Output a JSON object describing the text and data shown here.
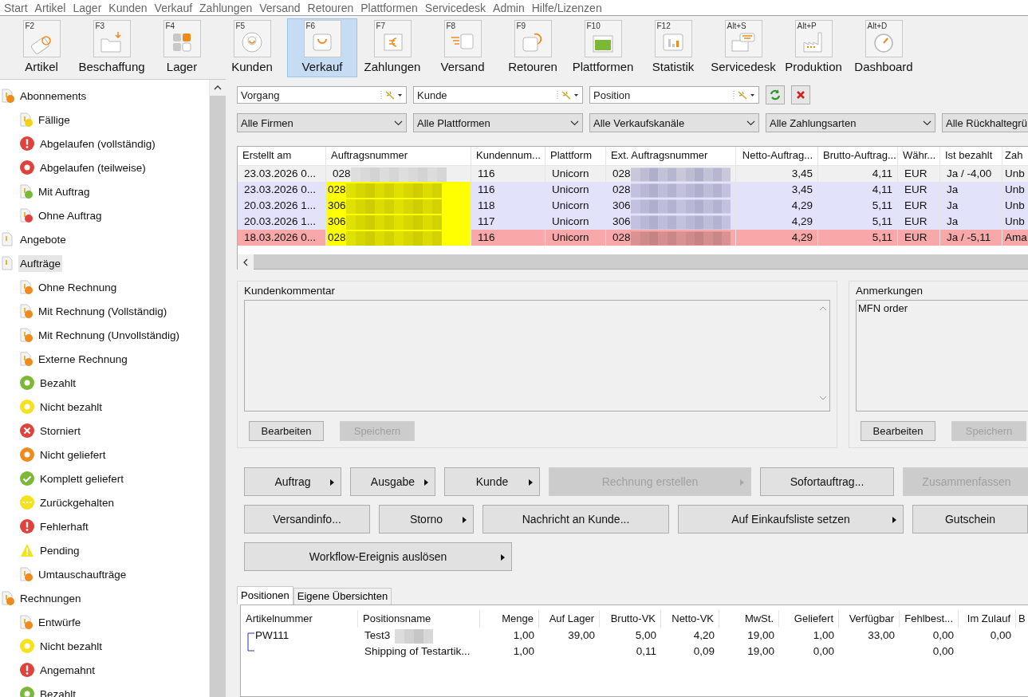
{
  "menu": [
    "Start",
    "Artikel",
    "Lager",
    "Kunden",
    "Verkauf",
    "Zahlungen",
    "Versand",
    "Retouren",
    "Plattformen",
    "Servicedesk",
    "Admin",
    "Hilfe/Lizenzen"
  ],
  "toolbar": [
    {
      "key": "F2",
      "label": "Artikel",
      "selected": false
    },
    {
      "key": "F3",
      "label": "Beschaffung",
      "selected": false
    },
    {
      "key": "F4",
      "label": "Lager",
      "selected": false
    },
    {
      "key": "F5",
      "label": "Kunden",
      "selected": false
    },
    {
      "key": "F6",
      "label": "Verkauf",
      "selected": true
    },
    {
      "key": "F7",
      "label": "Zahlungen",
      "selected": false
    },
    {
      "key": "F8",
      "label": "Versand",
      "selected": false
    },
    {
      "key": "F9",
      "label": "Retouren",
      "selected": false
    },
    {
      "key": "F10",
      "label": "Plattformen",
      "selected": false
    },
    {
      "key": "F12",
      "label": "Statistik",
      "selected": false
    },
    {
      "key": "Alt+S",
      "label": "Servicedesk",
      "selected": false
    },
    {
      "key": "Alt+P",
      "label": "Produktion",
      "selected": false
    },
    {
      "key": "Alt+D",
      "label": "Dashboard",
      "selected": false
    }
  ],
  "sidebar": {
    "items": [
      {
        "label": "Abonnements",
        "kind": "doc",
        "color": "#f08a1c",
        "selected": false,
        "children": [
          {
            "label": "Fällige",
            "kind": "doc",
            "color": "#f5d21a",
            "selected": false
          },
          {
            "label": "Abgelaufen (vollständig)",
            "kind": "alert",
            "color": "#e0413a",
            "selected": false
          },
          {
            "label": "Abgelaufen (teilweise)",
            "kind": "ring",
            "color": "#e0413a",
            "selected": false
          },
          {
            "label": "Mit Auftrag",
            "kind": "doc",
            "color": "#7ab836",
            "selected": false
          },
          {
            "label": "Ohne Auftrag",
            "kind": "doc",
            "color": "#e0413a",
            "selected": false
          }
        ]
      },
      {
        "label": "Angebote",
        "kind": "doc",
        "selected": false
      },
      {
        "label": "Aufträge",
        "kind": "doc",
        "selected": true,
        "children": [
          {
            "label": "Ohne Rechnung",
            "kind": "doc",
            "color": "#f08a1c",
            "selected": false
          },
          {
            "label": "Mit Rechnung (Vollständig)",
            "kind": "doc",
            "color": "#f08a1c",
            "selected": false
          },
          {
            "label": "Mit Rechnung (Unvollständig)",
            "kind": "doc",
            "color": "#f08a1c",
            "selected": false
          },
          {
            "label": "Externe Rechnung",
            "kind": "doc",
            "color": "#f08a1c",
            "selected": false
          },
          {
            "label": "Bezahlt",
            "kind": "ring",
            "color": "#7ab836",
            "selected": false
          },
          {
            "label": "Nicht bezahlt",
            "kind": "ring",
            "color": "#f5e21a",
            "selected": false
          },
          {
            "label": "Storniert",
            "kind": "cross",
            "color": "#e0413a",
            "selected": false
          },
          {
            "label": "Nicht geliefert",
            "kind": "ring",
            "color": "#f08a1c",
            "selected": false
          },
          {
            "label": "Komplett geliefert",
            "kind": "check",
            "color": "#7ab836",
            "selected": false
          },
          {
            "label": "Zurückgehalten",
            "kind": "dots",
            "color": "#f5e21a",
            "selected": false
          },
          {
            "label": "Fehlerhaft",
            "kind": "alert",
            "color": "#e0413a",
            "selected": false
          },
          {
            "label": "Pending",
            "kind": "warn",
            "color": "#f5e21a",
            "selected": false
          },
          {
            "label": "Umtauschaufträge",
            "kind": "doc",
            "color": "#f08a1c",
            "selected": false
          }
        ]
      },
      {
        "label": "Rechnungen",
        "kind": "doc",
        "color": "#f08a1c",
        "selected": false,
        "children": [
          {
            "label": "Entwürfe",
            "kind": "doc",
            "color": "#f08a1c",
            "selected": false
          },
          {
            "label": "Nicht bezahlt",
            "kind": "ring",
            "color": "#f5e21a",
            "selected": false
          },
          {
            "label": "Angemahnt",
            "kind": "alert",
            "color": "#e0413a",
            "selected": false
          },
          {
            "label": "Bezahlt",
            "kind": "ring",
            "color": "#7ab836",
            "selected": false
          }
        ]
      }
    ]
  },
  "search_fields": [
    {
      "placeholder": "Vorgang"
    },
    {
      "placeholder": "Kunde"
    },
    {
      "placeholder": "Position"
    }
  ],
  "filters": [
    "Alle Firmen",
    "Alle Plattformen",
    "Alle Verkaufskanäle",
    "Alle Zahlungsarten",
    "Alle Rückhaltegrü"
  ],
  "orders": {
    "columns": [
      {
        "label": "Erstellt am"
      },
      {
        "label": "Auftragsnummer"
      },
      {
        "label": "Kundennum..."
      },
      {
        "label": "Plattform"
      },
      {
        "label": "Ext. Auftragsnummer"
      },
      {
        "label": "Netto-Auftrag..."
      },
      {
        "label": "Brutto-Auftrag..."
      },
      {
        "label": "Währ..."
      },
      {
        "label": "Ist bezahlt"
      },
      {
        "label": "Zah"
      }
    ],
    "rows": [
      {
        "color": "#f0f0f0",
        "highlight": false,
        "cells": [
          "23.03.2026 0...",
          "028",
          "116",
          "Unicorn",
          "028",
          "3,45",
          "4,11",
          "EUR",
          "Ja / -4,00",
          "Unb"
        ]
      },
      {
        "color": "#e2e2fa",
        "highlight": true,
        "cells": [
          "23.03.2026 0...",
          "028",
          "116",
          "Unicorn",
          "028",
          "3,45",
          "4,11",
          "EUR",
          "Ja",
          "Unb"
        ]
      },
      {
        "color": "#e2e2fa",
        "highlight": true,
        "cells": [
          "20.03.2026 1...",
          "306",
          "118",
          "Unicorn",
          "306",
          "4,29",
          "5,11",
          "EUR",
          "Ja",
          "Unb"
        ]
      },
      {
        "color": "#e2e2fa",
        "highlight": true,
        "cells": [
          "20.03.2026 1...",
          "306",
          "117",
          "Unicorn",
          "306",
          "4,29",
          "5,11",
          "EUR",
          "Ja",
          "Unb"
        ]
      },
      {
        "color": "#f8a8a8",
        "highlight": true,
        "cells": [
          "18.03.2026 0...",
          "028",
          "116",
          "Unicorn",
          "028",
          "4,29",
          "5,11",
          "EUR",
          "Ja / -5,11",
          "Ama"
        ]
      }
    ]
  },
  "comments": [
    {
      "title": "Kundenkommentar",
      "buttons": [
        {
          "label": "Bearbeiten",
          "disabled": false
        },
        {
          "label": "Speichern",
          "disabled": true
        }
      ]
    },
    {
      "title": "Anmerkungen",
      "text": "MFN order",
      "buttons": [
        {
          "label": "Bearbeiten",
          "disabled": false
        },
        {
          "label": "Speichern",
          "disabled": true
        }
      ]
    }
  ],
  "actions": [
    [
      {
        "label": "Auftrag",
        "arrow": true,
        "disabled": false
      },
      {
        "label": "Ausgabe",
        "arrow": true,
        "disabled": false
      },
      {
        "label": "Kunde",
        "arrow": true,
        "disabled": false
      },
      {
        "label": "Rechnung erstellen",
        "arrow": true,
        "disabled": true
      },
      {
        "label": "Sofortauftrag...",
        "arrow": false,
        "disabled": false
      },
      {
        "label": "Zusammenfassen",
        "arrow": false,
        "disabled": true
      }
    ],
    [
      {
        "label": "Versandinfo...",
        "arrow": false,
        "disabled": false
      },
      {
        "label": "Storno",
        "arrow": true,
        "disabled": false
      },
      {
        "label": "Nachricht an Kunde...",
        "arrow": false,
        "disabled": false
      },
      {
        "label": "Auf Einkaufsliste setzen",
        "arrow": true,
        "disabled": false
      },
      {
        "label": "Gutschein",
        "arrow": false,
        "disabled": false
      }
    ],
    [
      {
        "label": "Workflow-Ereignis auslösen",
        "arrow": true,
        "disabled": false
      }
    ]
  ],
  "tabs": [
    {
      "label": "Positionen",
      "selected": true
    },
    {
      "label": "Eigene Übersichten",
      "selected": false
    }
  ],
  "positions": {
    "columns": [
      {
        "label": "Artikelnummer"
      },
      {
        "label": "Positionsname"
      },
      {
        "label": "Menge"
      },
      {
        "label": "Auf Lager"
      },
      {
        "label": "Brutto-VK"
      },
      {
        "label": "Netto-VK"
      },
      {
        "label": "MwSt."
      },
      {
        "label": "Geliefert"
      },
      {
        "label": "Verfügbar"
      },
      {
        "label": "Fehlbest..."
      },
      {
        "label": "Im Zulauf"
      },
      {
        "label": "B"
      }
    ],
    "rows": [
      {
        "cells": [
          "PW111",
          "Test3",
          "1,00",
          "39,00",
          "5,00",
          "4,20",
          "19,00",
          "1,00",
          "33,00",
          "0,00",
          "0,00",
          ""
        ]
      },
      {
        "cells": [
          "",
          "Shipping of Testartik...",
          "1,00",
          "",
          "0,11",
          "0,09",
          "19,00",
          "0,00",
          "",
          "0,00",
          "",
          ""
        ]
      }
    ]
  }
}
